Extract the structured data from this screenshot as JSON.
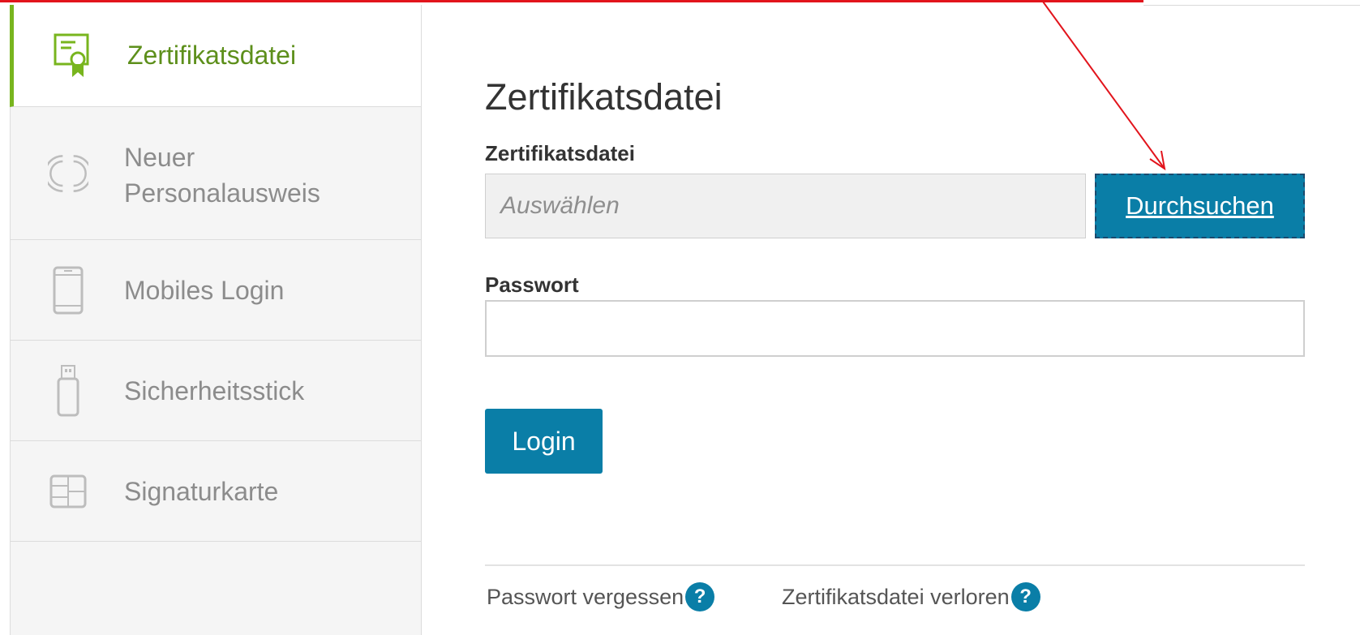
{
  "sidebar": {
    "items": [
      {
        "label": "Zertifikatsdatei",
        "icon": "certificate-icon",
        "active": true
      },
      {
        "label": "Neuer Personalausweis",
        "icon": "id-card-nfc-icon",
        "active": false
      },
      {
        "label": "Mobiles Login",
        "icon": "mobile-phone-icon",
        "active": false
      },
      {
        "label": "Sicherheitsstick",
        "icon": "usb-stick-icon",
        "active": false
      },
      {
        "label": "Signaturkarte",
        "icon": "smart-card-icon",
        "active": false
      }
    ]
  },
  "main": {
    "title": "Zertifikatsdatei",
    "file_label": "Zertifikatsdatei",
    "file_placeholder": "Auswählen",
    "browse_label": "Durchsuchen",
    "password_label": "Passwort",
    "password_value": "",
    "login_label": "Login",
    "links": [
      {
        "label": "Passwort vergessen",
        "help": "?"
      },
      {
        "label": "Zertifikatsdatei verloren",
        "help": "?"
      }
    ]
  },
  "colors": {
    "accent_green": "#78b51e",
    "primary_blue": "#0a7ea7",
    "annotation_red": "#e2141c"
  }
}
